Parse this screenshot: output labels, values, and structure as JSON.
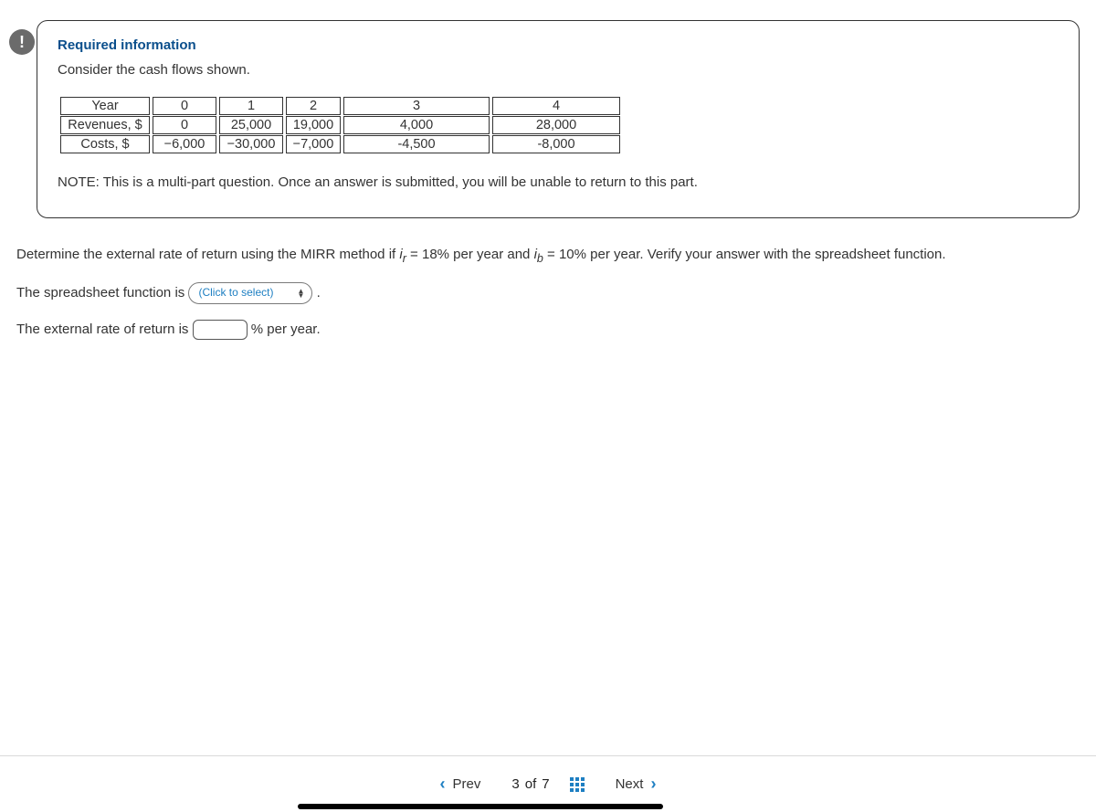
{
  "badge": {
    "symbol": "!"
  },
  "card": {
    "title": "Required information",
    "intro": "Consider the cash flows shown.",
    "note": "NOTE: This is a multi-part question. Once an answer is submitted, you will be unable to return to this part."
  },
  "table": {
    "headers": {
      "label": "Year",
      "c0": "0",
      "c1": "1",
      "c2": "2",
      "c3": "3",
      "c4": "4"
    },
    "revenues": {
      "label": "Revenues, $",
      "c0": "0",
      "c1": "25,000",
      "c2": "19,000",
      "c3": "4,000",
      "c4": "28,000"
    },
    "costs": {
      "label": "Costs, $",
      "c0": "−6,000",
      "c1": "−30,000",
      "c2": "−7,000",
      "c3": "-4,500",
      "c4": "-8,000"
    }
  },
  "question": {
    "prompt_pre": "Determine the external rate of return using the MIRR method if ",
    "ir_label": "i",
    "ir_sub": "r",
    "ir_val": " = 18% per year and ",
    "ib_label": "i",
    "ib_sub": "b",
    "ib_val": " = 10% per year. Verify your answer with the spreadsheet function.",
    "line1_pre": "The spreadsheet function is ",
    "select_placeholder": "(Click to select)",
    "line1_post": " .",
    "line2_pre": "The external rate of return is ",
    "line2_post": " % per year."
  },
  "nav": {
    "prev": "Prev",
    "next": "Next",
    "current": "3",
    "of": "of",
    "total": "7"
  }
}
